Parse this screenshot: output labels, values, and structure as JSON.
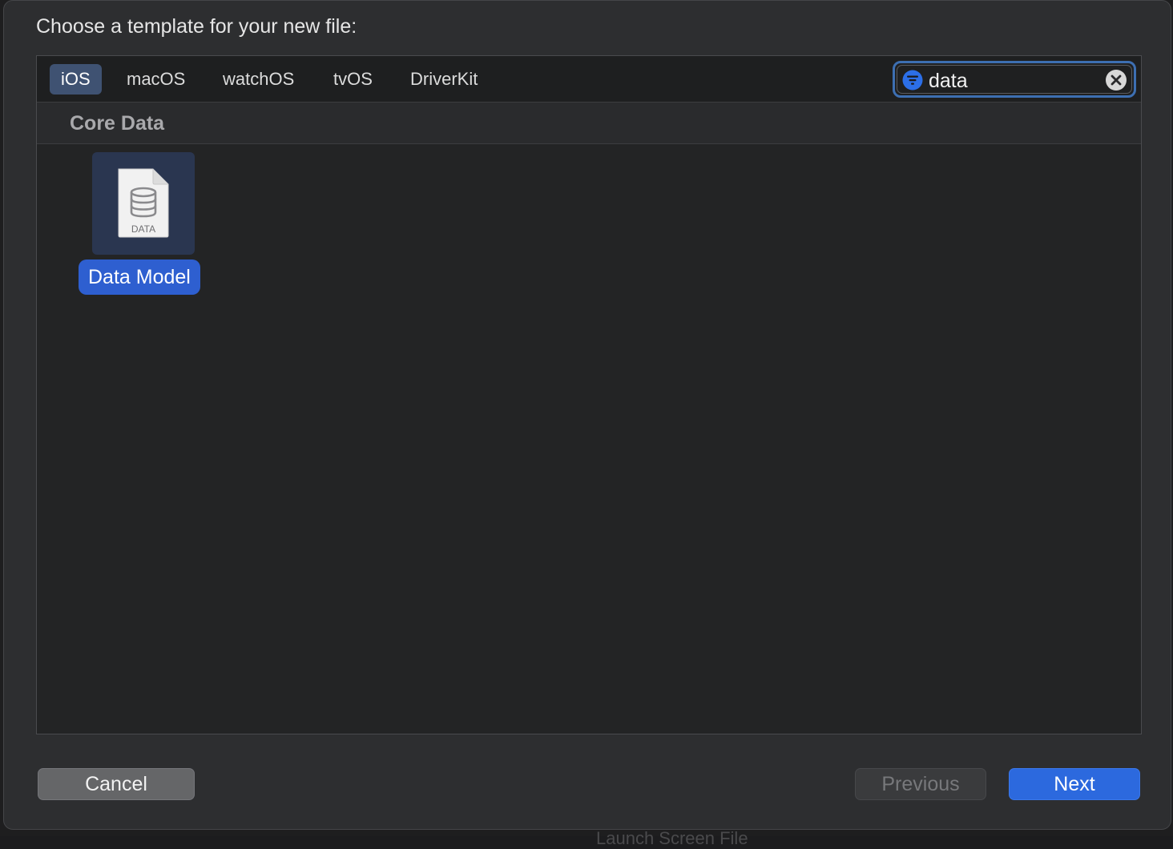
{
  "dialog": {
    "title": "Choose a template for your new file:"
  },
  "platform_tabs": [
    {
      "label": "iOS",
      "selected": true
    },
    {
      "label": "macOS",
      "selected": false
    },
    {
      "label": "watchOS",
      "selected": false
    },
    {
      "label": "tvOS",
      "selected": false
    },
    {
      "label": "DriverKit",
      "selected": false
    }
  ],
  "search": {
    "value": "data",
    "filter_icon": "filter-icon",
    "clear_icon": "clear-icon"
  },
  "section": {
    "title": "Core Data"
  },
  "templates": [
    {
      "label": "Data Model",
      "icon": "data-model-icon",
      "icon_caption": "DATA",
      "selected": true
    }
  ],
  "footer": {
    "cancel_label": "Cancel",
    "previous_label": "Previous",
    "next_label": "Next"
  },
  "background": {
    "partial_text": "Launch Screen File"
  },
  "colors": {
    "accent": "#2c69de",
    "selected_tab": "#3f5272",
    "selected_item": "#2e5fd0"
  }
}
